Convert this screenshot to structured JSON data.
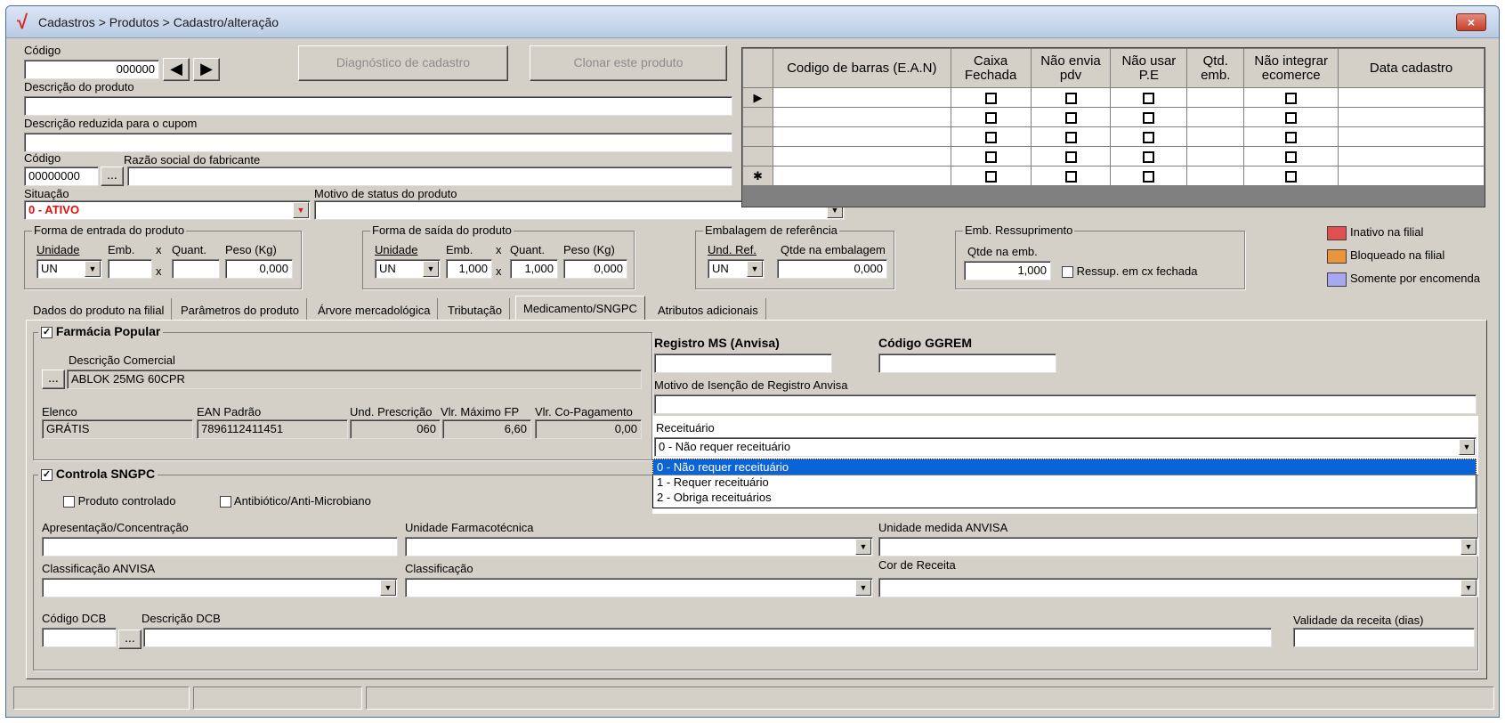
{
  "window": {
    "title": "Cadastros > Produtos > Cadastro/alteração",
    "close_label": "×"
  },
  "header": {
    "codigo_label": "Código",
    "codigo_value": "000000",
    "diag_button": "Diagnóstico de cadastro",
    "clone_button": "Clonar este produto",
    "descricao_label": "Descrição  do produto",
    "descricao_value": "",
    "descricao_reduzida_label": "Descrição reduzida para o cupom",
    "descricao_reduzida_value": "",
    "fab_codigo_label": "Código",
    "fab_codigo_value": "00000000",
    "fab_razao_label": "Razão social do fabricante",
    "fab_razao_value": "",
    "situacao_label": "Situação",
    "situacao_value": "0 - ATIVO",
    "motivo_label": "Motivo de status do produto",
    "motivo_value": ""
  },
  "ean_grid": {
    "columns": [
      "Codigo de barras (E.A.N)",
      "Caixa Fechada",
      "Não envia pdv",
      "Não usar P.E",
      "Qtd. emb.",
      "Não integrar ecomerce",
      "Data cadastro"
    ],
    "row_indicators": [
      "▶",
      "",
      "",
      "",
      "✱"
    ]
  },
  "entrada": {
    "title": "Forma de entrada do produto",
    "unidade_label": "Unidade",
    "unidade_value": "UN",
    "emb_label": "Emb.",
    "emb_value": "",
    "quant_label": "Quant.",
    "quant_value": "",
    "peso_label": "Peso (Kg)",
    "peso_value": "0,000",
    "x": "x"
  },
  "saida": {
    "title": "Forma de saída do produto",
    "unidade_label": "Unidade",
    "unidade_value": "UN",
    "emb_label": "Emb.",
    "emb_value": "1,000",
    "quant_label": "Quant.",
    "quant_value": "1,000",
    "peso_label": "Peso (Kg)",
    "peso_value": "0,000",
    "x": "x"
  },
  "embalagem": {
    "title": "Embalagem de referência",
    "und_label": "Und. Ref.",
    "und_value": "UN",
    "qtde_label": "Qtde na embalagem",
    "qtde_value": "0,000"
  },
  "ressup": {
    "title": "Emb. Ressuprimento",
    "qtde_label": "Qtde na emb.",
    "qtde_value": "1,000",
    "cx_label": "Ressup. em cx fechada"
  },
  "legend": [
    {
      "label": "Inativo na filial",
      "color": "#e05050"
    },
    {
      "label": "Bloqueado na filial",
      "color": "#e8963c"
    },
    {
      "label": "Somente por encomenda",
      "color": "#a8a8f0"
    }
  ],
  "tabs": [
    "Dados do produto na filial",
    "Parâmetros do produto",
    "Árvore mercadológica",
    "Tributação",
    "Medicamento/SNGPC",
    "Atributos adicionais"
  ],
  "farmacia": {
    "title": "Farmácia Popular",
    "desc_label": "Descrição Comercial",
    "desc_value": "ABLOK 25MG 60CPR",
    "elenco_label": "Elenco",
    "elenco_value": "GRÁTIS",
    "ean_label": "EAN Padrão",
    "ean_value": "7896112411451",
    "und_label": "Und. Prescrição",
    "und_value": "060",
    "vmax_label": "Vlr. Máximo FP",
    "vmax_value": "6,60",
    "vco_label": "Vlr. Co-Pagamento",
    "vco_value": "0,00"
  },
  "registro": {
    "ms_label": "Registro MS (Anvisa)",
    "ms_value": "",
    "ggrem_label": "Código GGREM",
    "ggrem_value": "",
    "motivo_label": "Motivo de Isenção de Registro Anvisa",
    "motivo_value": "",
    "receituario_label": "Receituário",
    "receituario_value": "0 - Não requer receituário",
    "receituario_options": [
      "0 - Não requer receituário",
      "1 - Requer receituário",
      "2 - Obriga receituários"
    ]
  },
  "sngpc": {
    "title": "Controla SNGPC",
    "controlado_label": "Produto controlado",
    "antibiotico_label": "Antibiótico/Anti-Microbiano",
    "apresentacao_label": "Apresentação/Concentração",
    "unid_farm_label": "Unidade Farmacotécnica",
    "unid_anvisa_label": "Unidade medida ANVISA",
    "class_anvisa_label": "Classificação ANVISA",
    "classificacao_label": "Classificação",
    "cor_label": "Cor de  Receita",
    "dcb_cod_label": "Código DCB",
    "dcb_desc_label": "Descrição DCB",
    "validade_label": "Validade da receita (dias)"
  },
  "icons": {
    "prev": "arrow-left-icon",
    "next": "arrow-right-icon",
    "dropdown": "chevron-down-icon"
  }
}
